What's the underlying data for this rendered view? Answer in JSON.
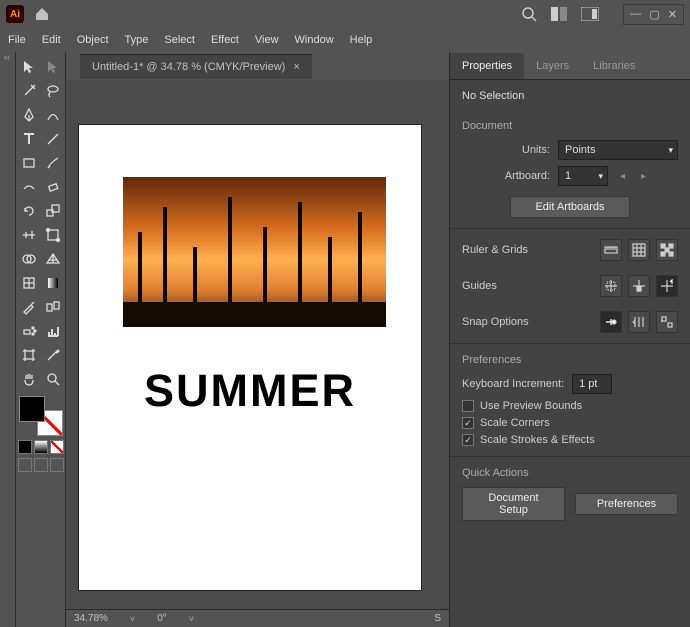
{
  "app": {
    "short": "Ai"
  },
  "menu": [
    "File",
    "Edit",
    "Object",
    "Type",
    "Select",
    "Effect",
    "View",
    "Window",
    "Help"
  ],
  "document": {
    "tab_title": "Untitled-1* @ 34.78 % (CMYK/Preview)",
    "close": "×"
  },
  "canvas": {
    "heading": "SUMMER"
  },
  "status": {
    "zoom": "34.78%",
    "rotate": "0°",
    "selection": "S"
  },
  "panel": {
    "tabs": {
      "properties": "Properties",
      "layers": "Layers",
      "libraries": "Libraries"
    },
    "no_selection": "No Selection",
    "document_section": "Document",
    "units_label": "Units:",
    "units_value": "Points",
    "artboard_label": "Artboard:",
    "artboard_value": "1",
    "edit_artboards": "Edit Artboards",
    "ruler_grids": "Ruler & Grids",
    "guides": "Guides",
    "snap_options": "Snap Options",
    "preferences_section": "Preferences",
    "keyboard_increment_label": "Keyboard Increment:",
    "keyboard_increment_value": "1 pt",
    "use_preview_bounds": "Use Preview Bounds",
    "scale_corners": "Scale Corners",
    "scale_strokes": "Scale Strokes & Effects",
    "quick_actions": "Quick Actions",
    "doc_setup": "Document Setup",
    "prefs_btn": "Preferences",
    "checks": {
      "scale_corners": "✓",
      "scale_strokes": "✓"
    }
  }
}
